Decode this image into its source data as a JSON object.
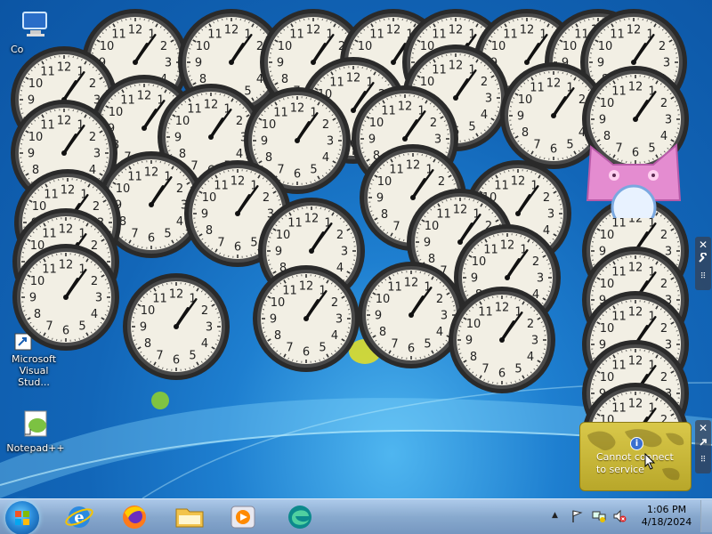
{
  "desktop": {
    "icons": [
      {
        "label": "Co",
        "icon": "computer-icon"
      },
      {
        "label": "Microsoft Visual Stud...",
        "icon": "visual-studio-shortcut-icon"
      },
      {
        "label": "Notepad++",
        "icon": "notepad-plus-plus-icon"
      }
    ]
  },
  "clock_gadget": {
    "numbers": [
      "12",
      "1",
      "2",
      "3",
      "4",
      "5",
      "6",
      "7",
      "8",
      "9",
      "10",
      "11"
    ],
    "time_shown": "1:06"
  },
  "weather_gadget": {
    "message_line1": "Cannot connect",
    "message_line2": "to service",
    "info_glyph": "i"
  },
  "gadget_controls": {
    "close_glyph": "✕",
    "settings_glyph": "🔧",
    "expand_glyph": "⇱"
  },
  "taskbar": {
    "pinned": [
      {
        "name": "internet-explorer-icon"
      },
      {
        "name": "firefox-icon"
      },
      {
        "name": "file-explorer-icon"
      },
      {
        "name": "media-player-icon"
      },
      {
        "name": "edge-icon"
      }
    ],
    "tray_expand_glyph": "▲",
    "time": "1:06 PM",
    "date": "4/18/2024"
  },
  "colors": {
    "desktop_blue": "#1266b8",
    "taskbar": "#a8c4e2",
    "clock_face": "#f2efe4",
    "clock_bezel": "#2a2a2a",
    "weather_yellow": "#c9b83a"
  }
}
